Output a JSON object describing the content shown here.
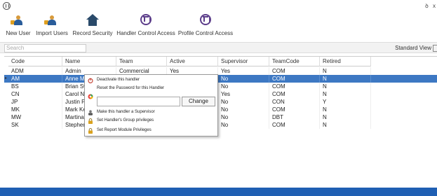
{
  "titlebar": {
    "right_glyphs": [
      "ꝺ",
      "x"
    ]
  },
  "toolbar": [
    {
      "label": "New User",
      "icon": "new-user-icon"
    },
    {
      "label": "Import Users",
      "icon": "import-users-icon"
    },
    {
      "label": "Record Security",
      "icon": "record-security-icon"
    },
    {
      "label": "Handler Control Access",
      "icon": "handler-control-icon"
    },
    {
      "label": "Profile Control Access",
      "icon": "profile-control-icon"
    }
  ],
  "search": {
    "placeholder": "Search"
  },
  "view": {
    "label": "Standard View"
  },
  "grid": {
    "columns": [
      "Code",
      "Name",
      "Team",
      "Active",
      "Supervisor",
      "TeamCode",
      "Retired"
    ],
    "rows": [
      [
        "ADM",
        "Admin",
        "Commercial",
        "Yes",
        "Yes",
        "COM",
        "N"
      ],
      [
        "AM",
        "Anne Me",
        "",
        "",
        "No",
        "COM",
        "N"
      ],
      [
        "BS",
        "Brian Sw",
        "",
        "",
        "No",
        "COM",
        "N"
      ],
      [
        "CN",
        "Carol Nc",
        "",
        "",
        "Yes",
        "COM",
        "N"
      ],
      [
        "JP",
        "Justin Ph",
        "",
        "",
        "No",
        "CON",
        "Y"
      ],
      [
        "MK",
        "Mark Ke",
        "",
        "",
        "No",
        "COM",
        "N"
      ],
      [
        "MW",
        "Martina",
        "",
        "",
        "No",
        "DBT",
        "N"
      ],
      [
        "SK",
        "Stephen",
        "",
        "",
        "No",
        "COM",
        "N"
      ]
    ],
    "selected_index": 1
  },
  "context_menu": {
    "deactivate": "Deactivate this handler",
    "reset_password": "Reset the Password for this Handler",
    "change_button": "Change",
    "make_supervisor": "Make this handler a Supervisor",
    "group_privileges": "Set Handler's Group privileges",
    "report_privileges": "Set Report Module Privileges"
  },
  "colors": {
    "selection": "#3d78c3",
    "statusbar": "#1f5fb3"
  }
}
